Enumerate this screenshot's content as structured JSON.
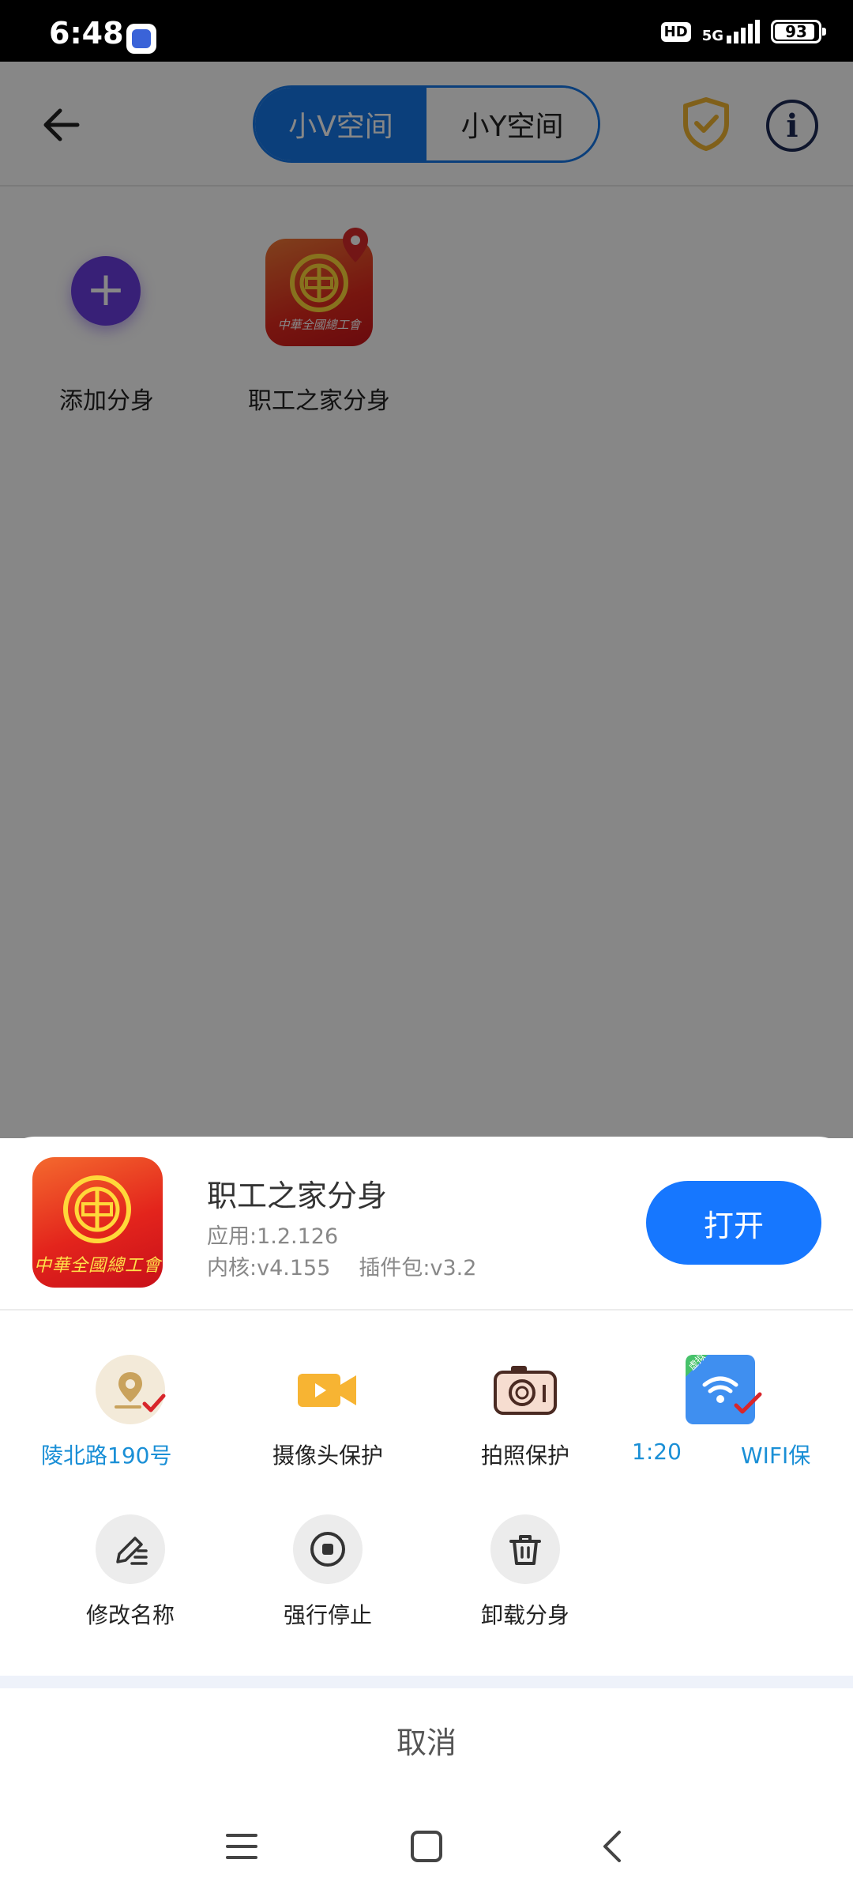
{
  "status_bar": {
    "time": "6:48",
    "hd": "HD",
    "network": "5G",
    "battery": "93",
    "battery_level": 93
  },
  "header": {
    "tabs": [
      {
        "label": "小V空间",
        "active": true
      },
      {
        "label": "小Y空间",
        "active": false
      }
    ],
    "accent_color": "#1677e8"
  },
  "apps": [
    {
      "label": "添加分身",
      "icon": "plus-icon"
    },
    {
      "label": "职工之家分身",
      "icon": "union-emblem-icon"
    }
  ],
  "sheet": {
    "app_name": "职工之家分身",
    "app_icon_text": "中華全國總工會",
    "version_app": "应用:1.2.126",
    "version_kernel": "内核:v4.155",
    "version_plugin": "插件包:v3.2",
    "open_label": "打开",
    "tools_row1": [
      {
        "label": "陵北路190号",
        "icon": "location-icon"
      },
      {
        "label": "摄像头保护",
        "icon": "camera-video-icon"
      },
      {
        "label": "拍照保护",
        "icon": "camera-icon"
      },
      {
        "label": "1:20",
        "icon": ""
      },
      {
        "label": "WIFI保",
        "icon": "wifi-icon",
        "badge": "虚拟"
      }
    ],
    "tools_row2": [
      {
        "label": "修改名称",
        "icon": "edit-icon"
      },
      {
        "label": "强行停止",
        "icon": "stop-icon"
      },
      {
        "label": "卸载分身",
        "icon": "trash-icon"
      }
    ],
    "cancel_label": "取消"
  },
  "nav": {
    "buttons": [
      "menu-icon",
      "home-icon",
      "back-icon"
    ]
  }
}
